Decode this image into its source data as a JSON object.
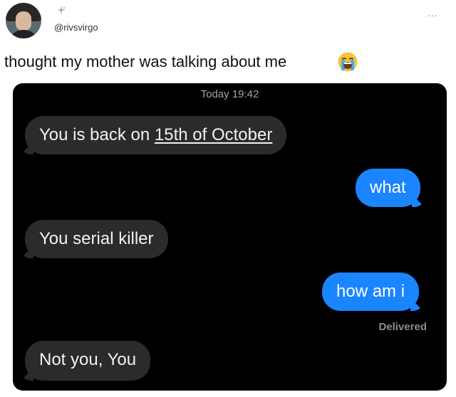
{
  "tweet": {
    "handle": "@rivsvirgo",
    "text": "thought my mother was talking about me",
    "more_label": "...",
    "emoji": "loudly-crying-face"
  },
  "chat": {
    "timestamp": "Today 19:42",
    "messages": [
      {
        "side": "received",
        "text_plain": "You is back on ",
        "text_link": "15th of October"
      },
      {
        "side": "sent",
        "text": "what"
      },
      {
        "side": "received",
        "text": "You serial killer"
      },
      {
        "side": "sent",
        "text": "how am i"
      },
      {
        "side": "received",
        "text": "Not you, You"
      }
    ],
    "status": "Delivered"
  },
  "colors": {
    "chat_background": "#000000",
    "received_bubble": "#2b2b2e",
    "sent_bubble": "#1b84ff"
  }
}
